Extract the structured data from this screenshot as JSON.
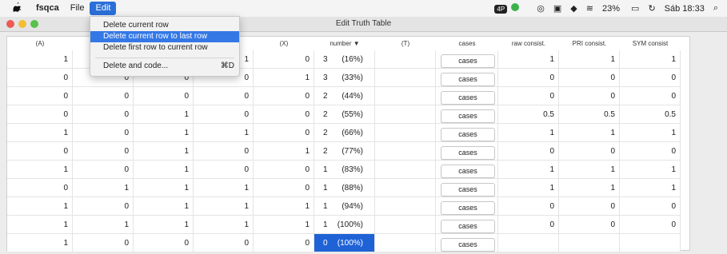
{
  "menubar": {
    "apple_glyph": "",
    "app_name": "fsqca",
    "file_label": "File",
    "edit_label": "Edit",
    "status": {
      "badge": "4P",
      "battery": "23%",
      "time": "Sáb 18:33"
    }
  },
  "window": {
    "title": "Edit Truth Table"
  },
  "edit_menu": {
    "items": [
      {
        "label": "Delete current row",
        "shortcut": ""
      },
      {
        "label": "Delete current row to last row",
        "shortcut": ""
      },
      {
        "label": "Delete first row to current row",
        "shortcut": ""
      },
      {
        "label": "Delete and code...",
        "shortcut": "⌘D"
      }
    ],
    "highlighted_index": 1
  },
  "table": {
    "headers": [
      "(A)",
      "",
      "",
      "",
      "(X)",
      "number ▼",
      "(T)",
      "cases",
      "raw consist.",
      "PRI consist.",
      "SYM consist"
    ],
    "button_label": "cases",
    "rows": [
      {
        "A": "1",
        "B": "",
        "C": "",
        "D": "1",
        "X": "0",
        "n": "3",
        "pct": "(16%)",
        "T": "",
        "raw": "1",
        "pri": "1",
        "sym": "1"
      },
      {
        "A": "0",
        "B": "0",
        "C": "0",
        "D": "0",
        "X": "1",
        "n": "3",
        "pct": "(33%)",
        "T": "",
        "raw": "0",
        "pri": "0",
        "sym": "0"
      },
      {
        "A": "0",
        "B": "0",
        "C": "0",
        "D": "0",
        "X": "0",
        "n": "2",
        "pct": "(44%)",
        "T": "",
        "raw": "0",
        "pri": "0",
        "sym": "0"
      },
      {
        "A": "0",
        "B": "0",
        "C": "1",
        "D": "0",
        "X": "0",
        "n": "2",
        "pct": "(55%)",
        "T": "",
        "raw": "0.5",
        "pri": "0.5",
        "sym": "0.5"
      },
      {
        "A": "1",
        "B": "0",
        "C": "1",
        "D": "1",
        "X": "0",
        "n": "2",
        "pct": "(66%)",
        "T": "",
        "raw": "1",
        "pri": "1",
        "sym": "1"
      },
      {
        "A": "0",
        "B": "0",
        "C": "1",
        "D": "0",
        "X": "1",
        "n": "2",
        "pct": "(77%)",
        "T": "",
        "raw": "0",
        "pri": "0",
        "sym": "0"
      },
      {
        "A": "1",
        "B": "0",
        "C": "1",
        "D": "0",
        "X": "0",
        "n": "1",
        "pct": "(83%)",
        "T": "",
        "raw": "1",
        "pri": "1",
        "sym": "1"
      },
      {
        "A": "0",
        "B": "1",
        "C": "1",
        "D": "1",
        "X": "0",
        "n": "1",
        "pct": "(88%)",
        "T": "",
        "raw": "1",
        "pri": "1",
        "sym": "1"
      },
      {
        "A": "1",
        "B": "0",
        "C": "1",
        "D": "1",
        "X": "1",
        "n": "1",
        "pct": "(94%)",
        "T": "",
        "raw": "0",
        "pri": "0",
        "sym": "0"
      },
      {
        "A": "1",
        "B": "1",
        "C": "1",
        "D": "1",
        "X": "1",
        "n": "1",
        "pct": "(100%)",
        "T": "",
        "raw": "0",
        "pri": "0",
        "sym": "0"
      },
      {
        "A": "1",
        "B": "0",
        "C": "0",
        "D": "0",
        "X": "0",
        "n": "0",
        "pct": "(100%)",
        "T": "",
        "raw": "",
        "pri": "",
        "sym": ""
      }
    ]
  },
  "colors": {
    "selection": "#1f62d6",
    "menu_highlight": "#3478e5"
  }
}
